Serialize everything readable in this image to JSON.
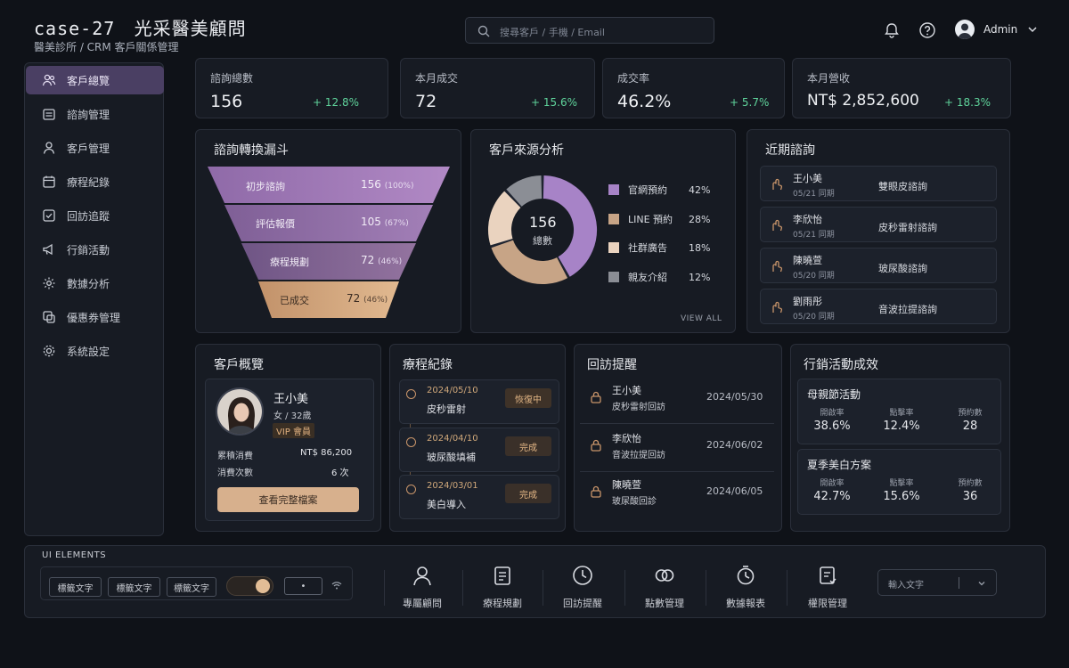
{
  "header": {
    "brand_code": "case-27",
    "brand_name": "光采醫美顧問",
    "breadcrumb": "醫美診所 / CRM 客戶關係管理",
    "search_placeholder": "搜尋客戶 / 手機 / Email",
    "user": "Admin"
  },
  "sidebar": {
    "items": [
      {
        "label": "客戶總覽",
        "icon": "users-icon",
        "active": true
      },
      {
        "label": "諮詢管理",
        "icon": "calendar-list-icon"
      },
      {
        "label": "客戶管理",
        "icon": "person-icon"
      },
      {
        "label": "療程紀錄",
        "icon": "calendar-icon"
      },
      {
        "label": "回訪追蹤",
        "icon": "check-square-icon"
      },
      {
        "label": "行銷活動",
        "icon": "megaphone-icon"
      },
      {
        "label": "數據分析",
        "icon": "chart-gear-icon"
      },
      {
        "label": "優惠券管理",
        "icon": "coupon-icon"
      },
      {
        "label": "系統設定",
        "icon": "gear-icon"
      }
    ]
  },
  "kpis": [
    {
      "label": "諮詢總數",
      "value": "156",
      "change": "+ 12.8%"
    },
    {
      "label": "本月成交",
      "value": "72",
      "change": "+ 15.6%"
    },
    {
      "label": "成交率",
      "value": "46.2%",
      "change": "+ 5.7%"
    },
    {
      "label": "本月營收",
      "value": "NT$ 2,852,600",
      "change": "+ 18.3%"
    }
  ],
  "funnel": {
    "title": "諮詢轉換漏斗",
    "stages": [
      {
        "label": "初步諮詢",
        "value": "156",
        "pct": "(100%)"
      },
      {
        "label": "評估報價",
        "value": "105",
        "pct": "(67%)"
      },
      {
        "label": "療程規劃",
        "value": "72",
        "pct": "(46%)"
      },
      {
        "label": "已成交",
        "value": "72",
        "pct": "(46%)"
      }
    ]
  },
  "source": {
    "title": "客戶來源分析",
    "center_value": "156",
    "center_label": "總數",
    "view_all": "VIEW ALL",
    "items": [
      {
        "label": "官網預約",
        "pct": "42%",
        "value": 42,
        "color": "#a783c7"
      },
      {
        "label": "LINE 預約",
        "pct": "28%",
        "value": 28,
        "color": "#c7a486"
      },
      {
        "label": "社群廣告",
        "pct": "18%",
        "value": 18,
        "color": "#ead3bf"
      },
      {
        "label": "親友介紹",
        "pct": "12%",
        "value": 12,
        "color": "#8b8e95"
      }
    ]
  },
  "recent": {
    "title": "近期諮詢",
    "items": [
      {
        "name": "王小美",
        "date": "05/21  同期",
        "topic": "雙眼皮諮詢"
      },
      {
        "name": "李欣怡",
        "date": "05/21  同期",
        "topic": "皮秒雷射諮詢"
      },
      {
        "name": "陳曉萱",
        "date": "05/20  同期",
        "topic": "玻尿酸諮詢"
      },
      {
        "name": "劉雨彤",
        "date": "05/20  同期",
        "topic": "音波拉提諮詢"
      }
    ]
  },
  "profile": {
    "title": "客戶概覽",
    "name": "王小美",
    "meta": "女 / 32歲",
    "tier": "VIP 會員",
    "spend_label": "累積消費",
    "spend_value": "NT$ 86,200",
    "visits_label": "消費次數",
    "visits_value": "6 次",
    "button": "查看完整檔案"
  },
  "treatments": {
    "title": "療程紀錄",
    "items": [
      {
        "date": "2024/05/10",
        "name": "皮秒雷射",
        "status": "恢復中"
      },
      {
        "date": "2024/04/10",
        "name": "玻尿酸填補",
        "status": "完成"
      },
      {
        "date": "2024/03/01",
        "name": "美白導入",
        "status": "完成"
      }
    ]
  },
  "followups": {
    "title": "回訪提醒",
    "items": [
      {
        "name": "王小美",
        "task": "皮秒雷射回訪",
        "date": "2024/05/30"
      },
      {
        "name": "李欣怡",
        "task": "音波拉提回訪",
        "date": "2024/06/02"
      },
      {
        "name": "陳曉萱",
        "task": "玻尿酸回診",
        "date": "2024/06/05"
      }
    ]
  },
  "marketing": {
    "title": "行銷活動成效",
    "campaigns": [
      {
        "name": "母親節活動",
        "metrics": [
          {
            "label": "開啟率",
            "value": "38.6%"
          },
          {
            "label": "點擊率",
            "value": "12.4%"
          },
          {
            "label": "預約數",
            "value": "28"
          }
        ]
      },
      {
        "name": "夏季美白方案",
        "metrics": [
          {
            "label": "開啟率",
            "value": "42.7%"
          },
          {
            "label": "點擊率",
            "value": "15.6%"
          },
          {
            "label": "預約數",
            "value": "36"
          }
        ]
      }
    ]
  },
  "ui_elements": {
    "title": "UI ELEMENTS",
    "tags": [
      "標籤文字",
      "標籤文字",
      "標籤文字"
    ],
    "stepper": "•",
    "toggle_on": true
  },
  "quick": [
    {
      "label": "專屬顧問",
      "icon": "advisor-icon"
    },
    {
      "label": "療程規劃",
      "icon": "plan-icon"
    },
    {
      "label": "回訪提醒",
      "icon": "clock-icon"
    },
    {
      "label": "點數管理",
      "icon": "points-icon"
    },
    {
      "label": "數據報表",
      "icon": "report-icon"
    },
    {
      "label": "權限管理",
      "icon": "permission-icon"
    }
  ],
  "text_input_placeholder": "輸入文字"
}
